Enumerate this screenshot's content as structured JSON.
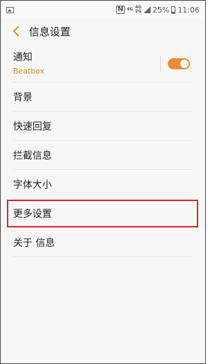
{
  "status": {
    "net_top": "4G",
    "net_mid": "4G",
    "net_bot": "2G",
    "battery": "25%",
    "time": "11:06",
    "icons": [
      "image-icon",
      "nfc-icon",
      "signal-icon",
      "battery-icon"
    ]
  },
  "header": {
    "title": "信息设置"
  },
  "notify": {
    "title": "通知",
    "subtitle": "Beatbox",
    "toggle_on": true
  },
  "items": [
    "背景",
    "快速回复",
    "拦截信息",
    "字体大小",
    "更多设置",
    "关于 信息"
  ],
  "colors": {
    "accent": "#f08a32",
    "subtitle": "#e58a2a",
    "highlight": "#d9252a"
  }
}
